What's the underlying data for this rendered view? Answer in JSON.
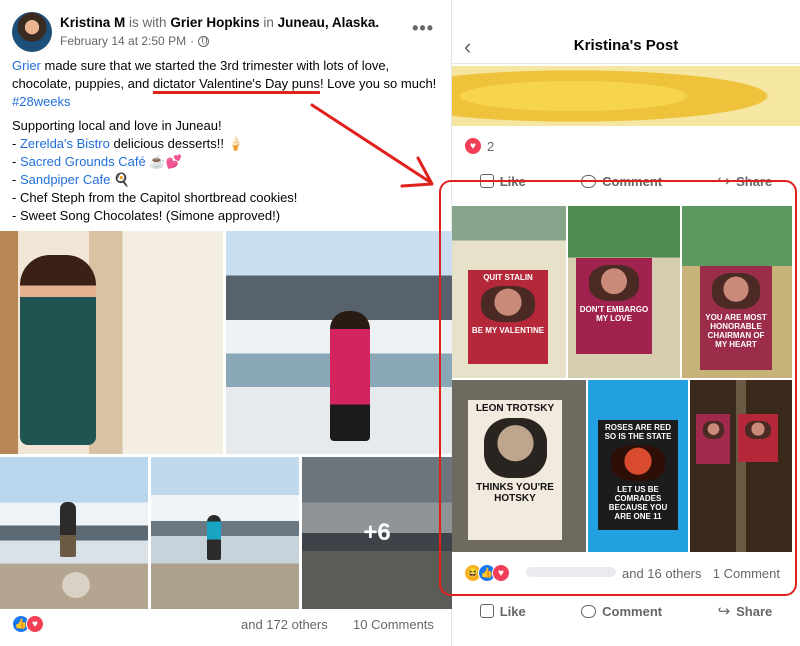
{
  "left_post": {
    "author": "Kristina M",
    "is_with_text": "is with",
    "tagged": "Grier Hopkins",
    "in_text": "in",
    "location": "Juneau, Alaska.",
    "timestamp": "February 14 at 2:50 PM",
    "dot": "·",
    "caption": {
      "grier": "Grier",
      "p1_a": " made sure that we started the 3rd trimester with lots of love, chocolate, puppies, and ",
      "p1_underlined": "dictator Valentine's Day puns",
      "p1_b": "! Love you so much! ",
      "hashtag": "#28weeks",
      "p2_intro": "Supporting local and love in Juneau!",
      "list": [
        {
          "prefix": "- ",
          "link": "Zerelda's Bistro",
          "rest": " delicious desserts!! 🍦"
        },
        {
          "prefix": "- ",
          "link": "Sacred Grounds Café",
          "rest": " ☕💕"
        },
        {
          "prefix": "- ",
          "link": "Sandpiper Cafe",
          "rest": " 🍳"
        },
        {
          "prefix": "",
          "link": "",
          "rest": "- Chef Steph from the Capitol shortbread cookies!"
        },
        {
          "prefix": "",
          "link": "",
          "rest": "- Sweet Song Chocolates! (Simone approved!)"
        }
      ]
    },
    "more_photos": "+6",
    "others_text": "and 172 others",
    "comments_text": "10 Comments",
    "icons": {
      "like": "👍",
      "love": "♥"
    }
  },
  "right_post": {
    "title": "Kristina's Post",
    "back": "‹",
    "reaction_count": "2",
    "actions": {
      "like": "Like",
      "comment": "Comment",
      "share": "Share"
    },
    "labels": {
      "stalin_top": "QUIT STALIN",
      "stalin_bottom": "BE MY VALENTINE",
      "castro": "DON'T EMBARGO MY LOVE",
      "mao": "YOU ARE MOST HONORABLE CHAIRMAN OF MY HEART",
      "trotsky_top": "LEON TROTSKY",
      "trotsky_bottom": "THINKS YOU'RE HOTSKY",
      "marx_top": "ROSES ARE RED SO IS THE STATE",
      "marx_bottom": "LET US BE COMRADES BECAUSE YOU ARE ONE 11"
    },
    "others_text": "and 16 others",
    "comments_text": "1 Comment",
    "icons": {
      "like": "👍",
      "love": "♥",
      "haha": "😆"
    }
  },
  "colors": {
    "link": "#216fdb",
    "annotation": "#e0211c",
    "like_blue": "#1877f2",
    "love_red": "#f33e58"
  }
}
